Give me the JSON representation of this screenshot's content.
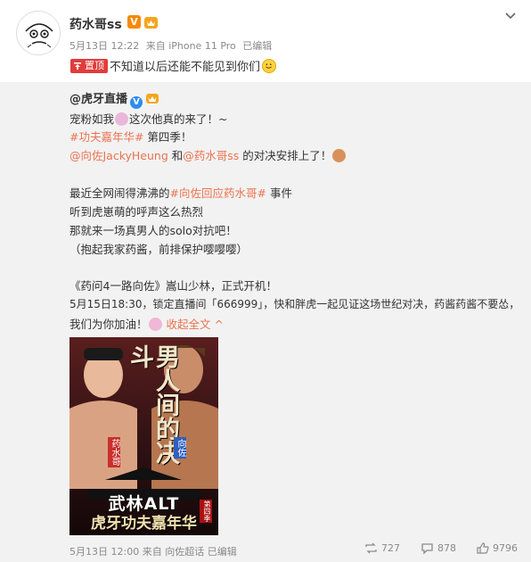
{
  "post": {
    "author": "药水哥ss",
    "v_badge": "V",
    "date": "5月13日 12:22",
    "source": "来自 iPhone 11 Pro",
    "edited": "已编辑",
    "pinned_label": "置顶",
    "text": "不知道以后还能不能见到你们"
  },
  "repost": {
    "author": "@虎牙直播",
    "v_badge": "V",
    "lines": {
      "l1a": "宠粉如我",
      "l1b": "这次他真的来了！~",
      "l2_topic": "#功夫嘉年华#",
      "l2b": " 第四季！",
      "l3_m1": "@向佐JackyHeung",
      "l3_and": " 和",
      "l3_m2": "@药水哥ss",
      "l3b": " 的对决安排上了！",
      "l4a": "最近全网闹得沸沸的",
      "l4_topic": "#向佐回应药水哥#",
      "l4b": " 事件",
      "l5": "听到虎崽萌的呼声这么热烈",
      "l6": "那就来一场真男人的solo对抗吧！",
      "l7": "（抱起我家药酱，前排保护嘤嘤嘤）",
      "l8": "《药问4一路向佐》嵩山少林，正式开机！",
      "l9": "5月15日18:30，锁定直播间「666999」，快和胖虎一起见证这场世纪对决，药酱药酱不要怂，",
      "l10a": "我们为你加油！",
      "l10_link": "收起全文 ^"
    },
    "poster": {
      "title": "男人间的决斗",
      "name_left": "药水哥",
      "name_right": "向佐",
      "bottom_title": "武林ALT",
      "bottom_sub": "虎牙功夫嘉年华",
      "season": "第四季"
    },
    "date": "5月13日 12:00",
    "source": "来自 向佐超话",
    "edited": "已编辑",
    "reposts": "727",
    "comments": "878",
    "likes": "9796"
  },
  "colors": {
    "link": "#eb7350",
    "pinned": "#e23c3c",
    "verified_orange": "#f78900",
    "verified_blue": "#2d8cf0",
    "repost_bg": "#f2f2f2"
  }
}
